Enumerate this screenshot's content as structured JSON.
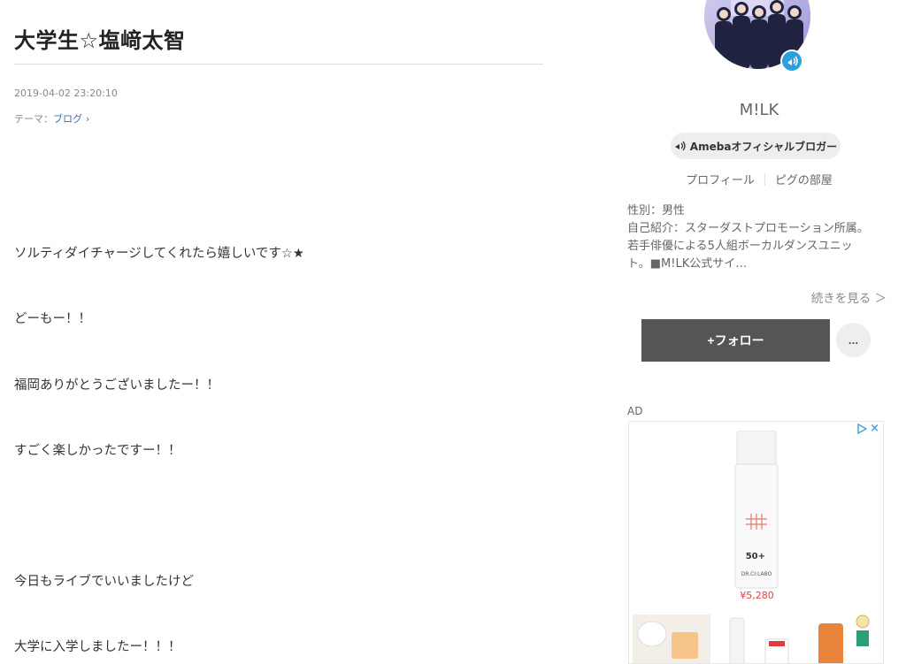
{
  "article": {
    "title": "大学生☆塩﨑太智",
    "date": "2019-04-02 23:20:10",
    "theme_prefix": "テーマ：",
    "theme_link": "ブログ",
    "lines": [
      "ソルティダイチャージしてくれたら嬉しいです☆★",
      "どーもー！！",
      "福岡ありがとうございましたー！！",
      "すごく楽しかったですー！！",
      "今日もライブでいいましたけど",
      "大学に入学しましたー！！！"
    ]
  },
  "profile": {
    "name": "M!LK",
    "official_badge": "Amebaオフィシャルブロガー",
    "links": [
      "プロフィール",
      "ピグの部屋"
    ],
    "bio_lines": [
      "性別：男性",
      "自己紹介：スターダストプロモーション所属。",
      "若手俳優による5人組ボーカルダンスユニッ",
      "ト。■M!LK公式サイ…"
    ],
    "more_link": "続きを見る ＞",
    "follow_button": "+フォロー",
    "menu_button": "…"
  },
  "ad": {
    "label": "AD",
    "price": "¥5,280",
    "product_text": "DR.CI:LABO",
    "spf": "50+",
    "close": "×"
  },
  "colors": {
    "link_blue": "#3a6fb0",
    "follow_bg": "#555555",
    "badge_blue": "#2d9fe0",
    "price_red": "#e04040"
  },
  "icons": {
    "theme_chevron": "chevron-right-icon",
    "official": "megaphone-icon",
    "ad_choices": "adchoices-icon",
    "ad_close": "close-icon"
  }
}
